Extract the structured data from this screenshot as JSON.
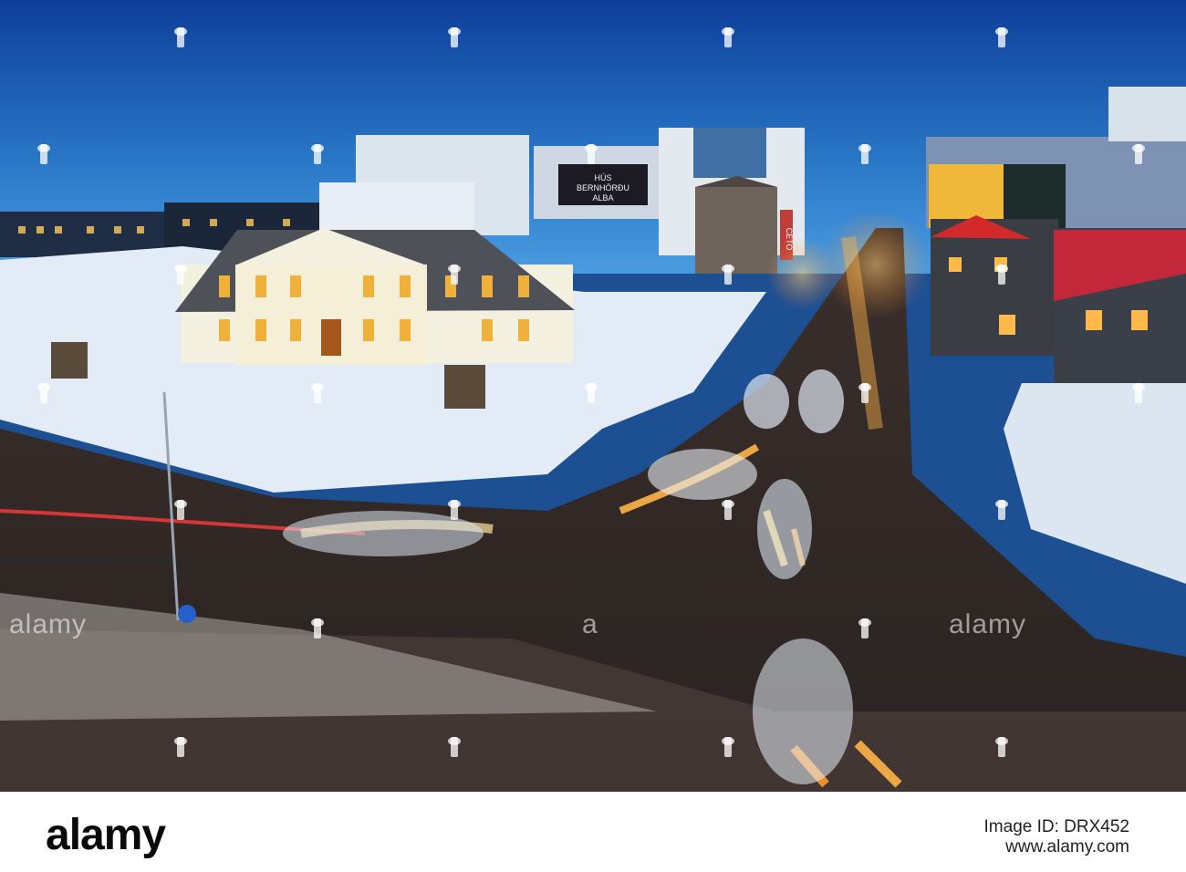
{
  "photo": {
    "description_colors": {
      "sky_top": "#0f49a8",
      "sky_bottom": "#3b8ad2",
      "snow": "#e6eef8",
      "street_glow": "#ff9a2e",
      "house_light": "#f4d36b"
    },
    "billboard_text_line1": "HÚS",
    "billboard_text_line2": "BERNHÖRÐU",
    "billboard_text_line3": "ALBA",
    "shop_sign": "CETO"
  },
  "watermark": {
    "left_word": "alamy",
    "center_word": "a",
    "right_word": "alamy"
  },
  "footer": {
    "logo": "alamy",
    "image_id": "Image ID: DRX452",
    "site": "www.alamy.com"
  }
}
